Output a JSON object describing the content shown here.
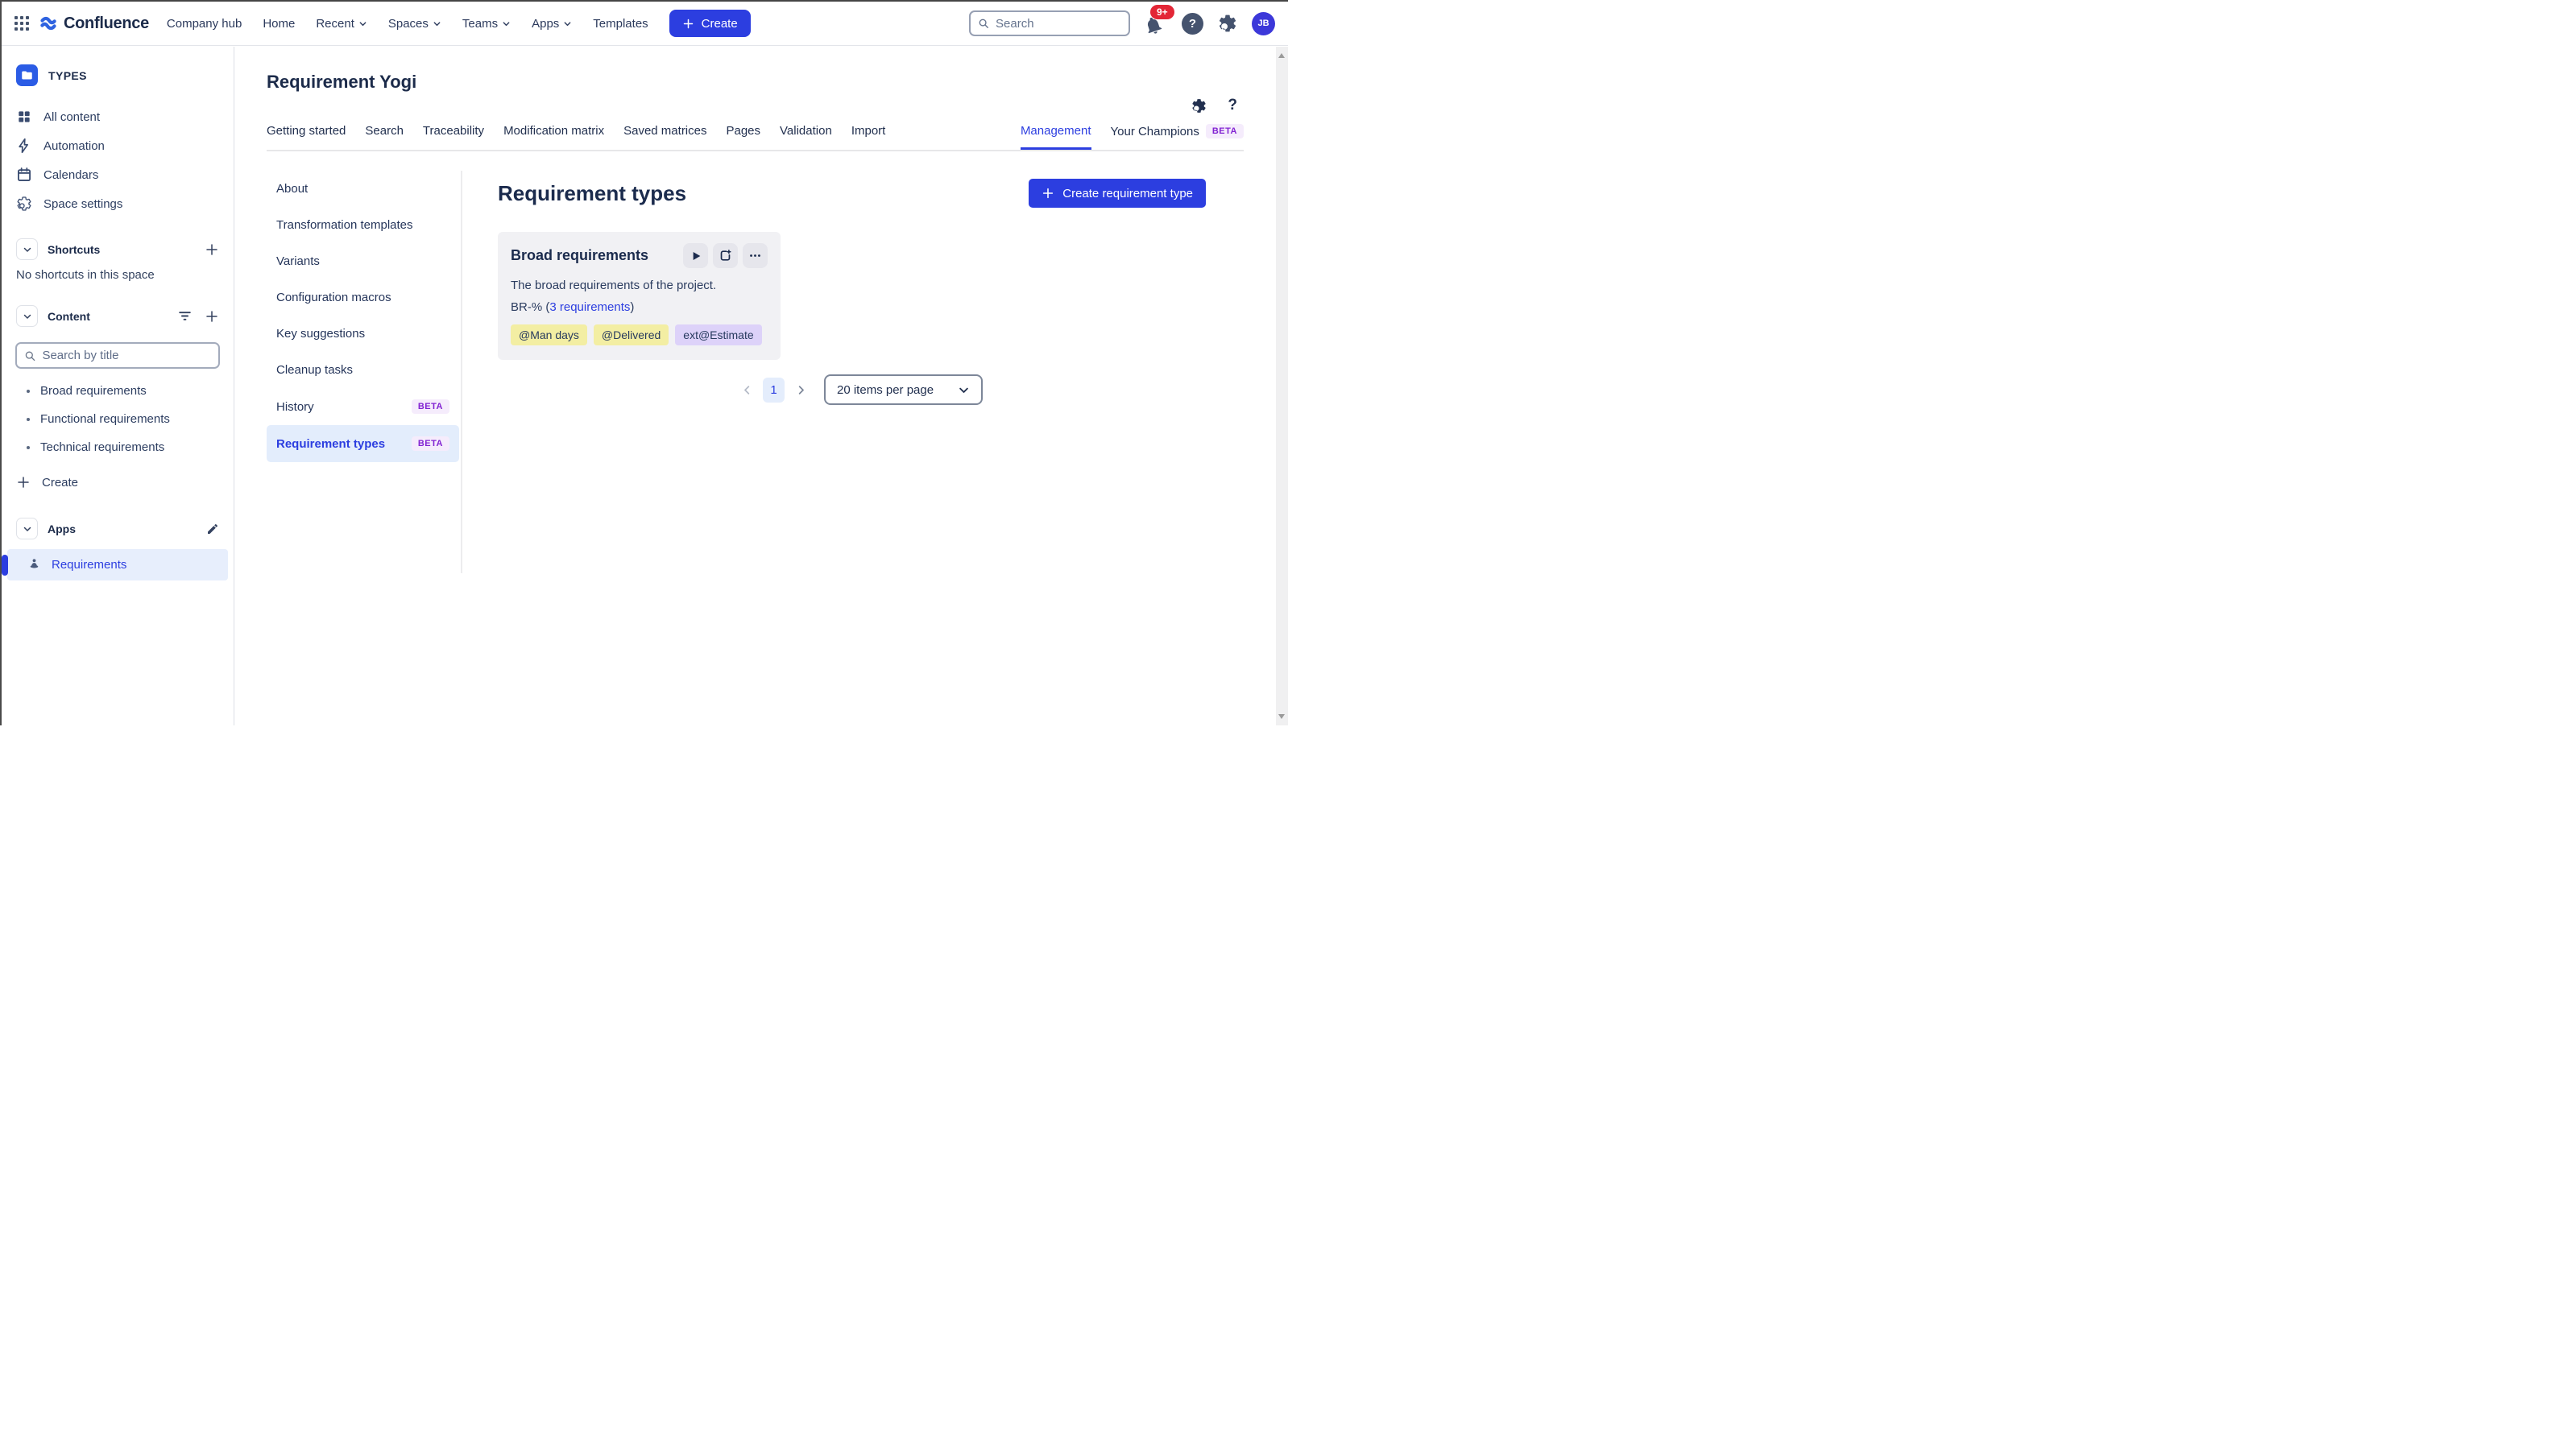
{
  "app_nav": {
    "product_name": "Confluence",
    "items": [
      {
        "label": "Company hub",
        "dropdown": false
      },
      {
        "label": "Home",
        "dropdown": false
      },
      {
        "label": "Recent",
        "dropdown": true
      },
      {
        "label": "Spaces",
        "dropdown": true
      },
      {
        "label": "Teams",
        "dropdown": true
      },
      {
        "label": "Apps",
        "dropdown": true
      },
      {
        "label": "Templates",
        "dropdown": false
      }
    ],
    "create_label": "Create",
    "search_placeholder": "Search",
    "notification_count": "9+",
    "help_glyph": "?",
    "avatar_initials": "JB"
  },
  "space_sidebar": {
    "space_name": "TYPES",
    "nav_items": [
      {
        "label": "All content",
        "icon": "grid-icon"
      },
      {
        "label": "Automation",
        "icon": "lightning-icon"
      },
      {
        "label": "Calendars",
        "icon": "calendar-icon"
      },
      {
        "label": "Space settings",
        "icon": "gear-icon"
      }
    ],
    "shortcuts": {
      "label": "Shortcuts",
      "empty_text": "No shortcuts in this space"
    },
    "content": {
      "label": "Content",
      "search_placeholder": "Search by title",
      "items": [
        "Broad requirements",
        "Functional requirements",
        "Technical requirements"
      ],
      "create_label": "Create"
    },
    "apps": {
      "label": "Apps",
      "item_label": "Requirements"
    }
  },
  "page": {
    "title": "Requirement Yogi",
    "help_glyph": "?",
    "tabs": [
      "Getting started",
      "Search",
      "Traceability",
      "Modification matrix",
      "Saved matrices",
      "Pages",
      "Validation",
      "Import"
    ],
    "right_tabs": [
      {
        "label": "Management",
        "active": true
      },
      {
        "label": "Your Champions",
        "badge": "BETA"
      }
    ]
  },
  "settings_nav": {
    "items": [
      {
        "label": "About"
      },
      {
        "label": "Transformation templates"
      },
      {
        "label": "Variants"
      },
      {
        "label": "Configuration macros"
      },
      {
        "label": "Key suggestions"
      },
      {
        "label": "Cleanup tasks"
      },
      {
        "label": "History",
        "badge": "BETA"
      },
      {
        "label": "Requirement types",
        "badge": "BETA",
        "selected": true
      }
    ]
  },
  "main": {
    "heading": "Requirement types",
    "create_button_label": "Create requirement type",
    "card": {
      "title": "Broad requirements",
      "description": "The broad requirements of the project.",
      "requirements_prefix": "BR-% (",
      "requirements_link": "3 requirements",
      "requirements_suffix": ")",
      "properties": [
        {
          "label": "@Man days",
          "bg": "#f3eea3"
        },
        {
          "label": "@Delivered",
          "bg": "#f3eea3"
        },
        {
          "label": "ext@Estimate",
          "bg": "#ddd2f9"
        }
      ]
    },
    "pagination": {
      "current_page": "1",
      "page_size_label": "20 items per page"
    }
  },
  "colors": {
    "accent_indigo": "#2c3ee0",
    "logo_blue": "#2f63e0",
    "space_icon_blue": "#2b5ce5",
    "notification_red": "#e32636",
    "beta_text": "#8223d2",
    "beta_bg": "#f5ecfc",
    "tag_yellow": "#f3eea3",
    "tag_purple": "#ddd2f9",
    "selected_row_blue": "#e3edfc",
    "card_gray": "#f1f1f4",
    "ink_navy": "#1b2b4d"
  }
}
